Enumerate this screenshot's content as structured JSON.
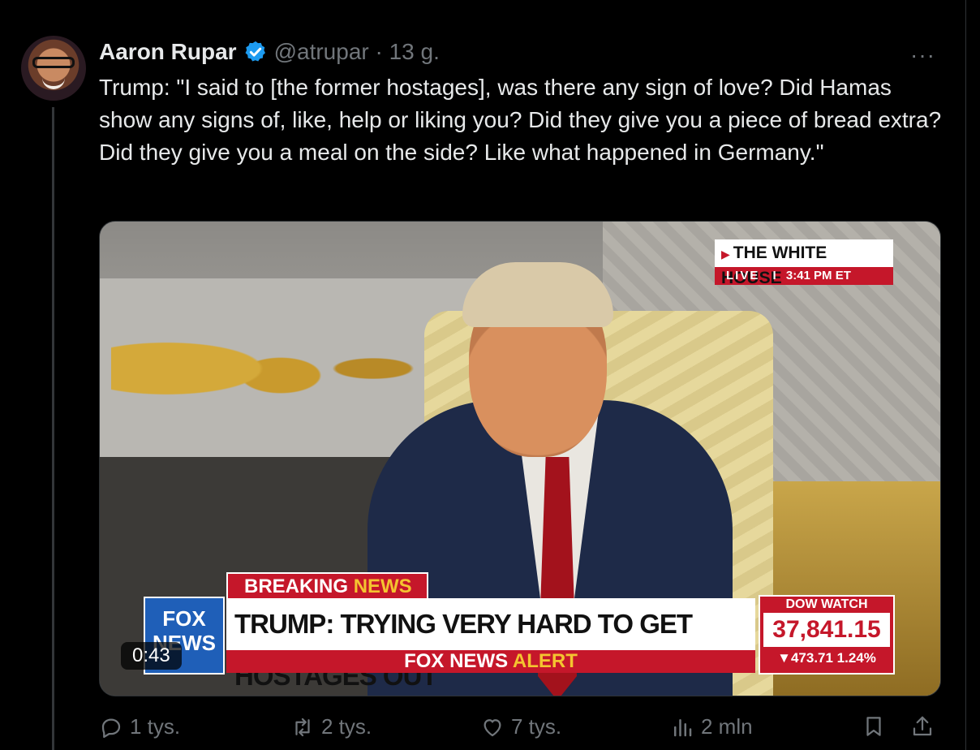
{
  "tweet": {
    "author_name": "Aaron Rupar",
    "handle_time": "@atrupar · 13 g.",
    "text": "Trump: \"I said to [the former hostages], was there any sign of love? Did Hamas show any signs of, like, help or liking you? Did they give you a piece of bread extra? Did they give you a meal on the side? Like what happened in Germany.\"",
    "more_label": "···"
  },
  "video": {
    "duration": "0:43",
    "overlay": {
      "channel_location": "THE WHITE HOUSE",
      "live": "LIVE",
      "separator": "I",
      "time": "3:41 PM ET",
      "breaking_part1": "BREAKING",
      "breaking_part2": "NEWS",
      "headline": "TRUMP: TRYING VERY HARD TO GET HOSTAGES OUT",
      "alert_part1": "FOX NEWS",
      "alert_part2": "ALERT",
      "logo_line1": "FOX",
      "logo_line2": "NEWS",
      "dow_title": "DOW WATCH",
      "dow_value": "37,841.15",
      "dow_change": "▼473.71 1.24%"
    }
  },
  "actions": {
    "replies": "1 tys.",
    "reposts": "2 tys.",
    "likes": "7 tys.",
    "views": "2 mln"
  },
  "colors": {
    "accent_blue": "#1d9bf0",
    "muted": "#71767b",
    "fox_red": "#c5172a",
    "fox_yellow": "#f4c430"
  }
}
